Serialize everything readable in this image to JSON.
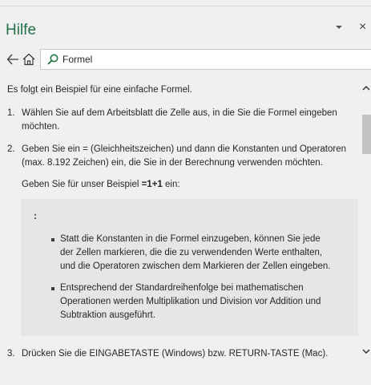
{
  "header": {
    "title": "Hilfe",
    "close_glyph": "×",
    "accent": "#217346"
  },
  "nav": {
    "back_icon": "arrow-left-icon",
    "home_icon": "home-icon"
  },
  "search": {
    "value": "Formel",
    "icon": "search-icon"
  },
  "article": {
    "intro": "Es folgt ein Beispiel für eine einfache Formel.",
    "step1": {
      "num": "1.",
      "line1": "Wählen Sie auf dem Arbeitsblatt die Zelle aus, in die Sie die Formel eingeben",
      "line2": "möchten."
    },
    "step2": {
      "num": "2.",
      "line1": "Geben Sie ein = (Gleichheitszeichen) und dann die Konstanten und Operatoren",
      "line2": "(max. 8.192 Zeichen) ein, die Sie in der Berechnung verwenden möchten.",
      "example_prefix": "Geben Sie für unser Beispiel ",
      "example_formula": "=1+1",
      "example_suffix": " ein:"
    },
    "tip": {
      "label": ":",
      "bullet1": {
        "line1": "Statt die Konstanten in die Formel einzugeben, können Sie jede",
        "line2": "der Zellen markieren, die die zu verwendenden Werte enthalten,",
        "line3": "und die Operatoren zwischen dem Markieren der Zellen eingeben."
      },
      "bullet2": {
        "line1": "Entsprechend der Standardreihenfolge bei mathematischen",
        "line2": "Operationen werden Multiplikation und Division vor Addition und",
        "line3": "Subtraktion ausgeführt."
      }
    },
    "step3": {
      "num": "3.",
      "text": "Drücken Sie die EINGABETASTE (Windows) bzw. RETURN-TASTE (Mac)."
    }
  }
}
